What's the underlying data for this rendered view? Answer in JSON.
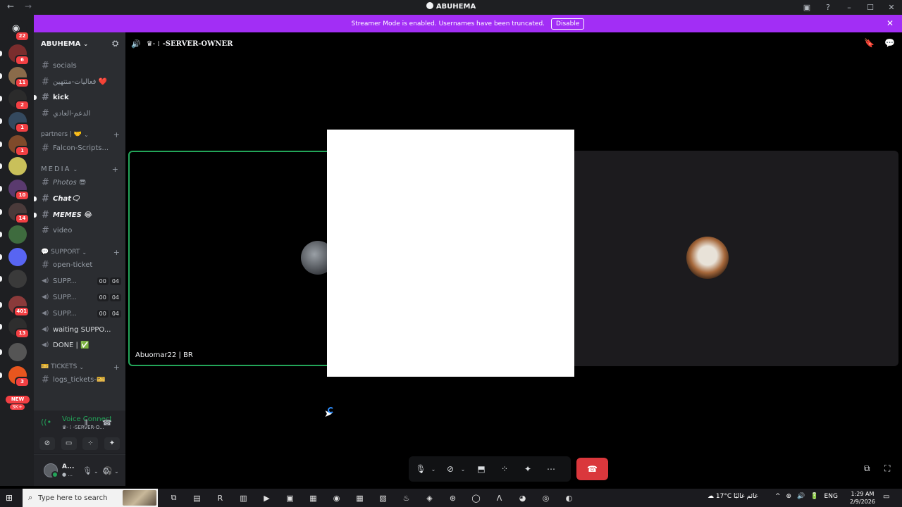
{
  "window": {
    "title": "ABUHEMA",
    "back_icon": "←",
    "forward_icon": "→",
    "controls": [
      "▣",
      "?",
      "–",
      "☐",
      "✕"
    ]
  },
  "banner": {
    "text": "Streamer Mode is enabled. Usernames have been truncated.",
    "button": "Disable",
    "close": "✕"
  },
  "rail": {
    "home_badge": "22",
    "servers": [
      {
        "badge": "6",
        "color": "#7a2d2d"
      },
      {
        "badge": "11",
        "color": "#8a6b4a"
      },
      {
        "badge": "2",
        "color": "#2b2b2b"
      },
      {
        "badge": "1",
        "color": "#34495e"
      },
      {
        "badge": "1",
        "color": "#7f4a2a"
      },
      {
        "badge": "",
        "color": "#c9c05a"
      },
      {
        "badge": "10",
        "color": "#5a3a6e"
      },
      {
        "badge": "14",
        "color": "#4a3a3a"
      },
      {
        "badge": "",
        "color": "#3e6b3e"
      },
      {
        "badge": "",
        "color": "#5865f2"
      },
      {
        "badge": "",
        "color": "#3a3a3a"
      },
      {
        "badge": "401",
        "color": "#8a3a3a"
      },
      {
        "badge": "13",
        "color": "#2e2e2e"
      },
      {
        "badge": "",
        "color": "#555555"
      },
      {
        "badge": "3",
        "color": "#e8561e"
      }
    ],
    "new_label": "NEW",
    "new_count": "3K+"
  },
  "sidebar": {
    "guild_name": "ABUHEMA",
    "chevron": "⌄",
    "invite_icon": "⛭",
    "channels_top": [
      {
        "name": "socials",
        "unread": false
      },
      {
        "name": "فعاليات-منتهين ❤️",
        "unread": false
      },
      {
        "name": "kick",
        "unread": true
      },
      {
        "name": "الدعم-العادي",
        "unread": false
      }
    ],
    "category_partners": "partners | 🤝",
    "channel_partner": "Falcon-Scripts...",
    "category_media": "MEDIA",
    "media_channels": [
      {
        "name": "Photos 😎",
        "unread": false
      },
      {
        "name": "Chat🗨",
        "unread": true
      },
      {
        "name": "MEMES 😂",
        "unread": true
      },
      {
        "name": "video",
        "unread": false
      }
    ],
    "category_support": "💬 SUPPORT",
    "support_text_channel": "open-ticket",
    "support_voice": [
      {
        "name": "SUPP...",
        "t1": "00",
        "t2": "04"
      },
      {
        "name": "SUPP...",
        "t1": "00",
        "t2": "04"
      },
      {
        "name": "SUPP...",
        "t1": "00",
        "t2": "04"
      }
    ],
    "waiting_channel": "waiting SUPPO...",
    "done_channel": "DONE | ✅",
    "category_tickets": "🎫 TICKETS",
    "logs_channel": "logs_tickets-🎫",
    "plus": "+"
  },
  "voice_panel": {
    "title": "Voice Connected",
    "subtitle": "♛- ⁞ -SERVER-O...",
    "signal_icon": "((•",
    "wave_icon": "⫴",
    "disconnect_icon": "☎",
    "buttons": [
      "⊘",
      "▭",
      "⁘",
      "✦"
    ]
  },
  "user_panel": {
    "name": "A...",
    "status": "● ...",
    "mic_icon": "🎙",
    "headset_icon": "🎧",
    "settings_icon": "⚙",
    "dropdown": "⌄"
  },
  "call": {
    "header_icon": "🔊",
    "channel_crown": "♛- ⁞",
    "channel_name": "-SERVER-OWNER",
    "header_right": [
      "🔖",
      "💬"
    ],
    "left_tile_label": "Abuomar22 | BR"
  },
  "controls": {
    "mic": "🎙",
    "camera": "⊘",
    "screen": "⬒",
    "activities": "⁘",
    "soundboard": "✦",
    "more": "⋯",
    "chevron": "⌄",
    "hangup": "☎",
    "popout": "⧉",
    "fullscreen": "⛶"
  },
  "taskbar": {
    "start": "⊞",
    "search_placeholder": "Type here to search",
    "search_icon": "⌕",
    "apps": [
      "⧉",
      "▤",
      "R",
      "▥",
      "▶",
      "▣",
      "▦",
      "◉",
      "▦",
      "▧",
      "♨",
      "◈",
      "⊛",
      "◯",
      "Λ",
      "◕",
      "◎",
      "◐"
    ],
    "weather": "☁ 17°C غائم غالبًا",
    "tray": [
      "^",
      "⊕",
      "🔊",
      "🔋",
      "ENG"
    ],
    "time": "1:29 AM",
    "date": "2/9/2026",
    "notifications": "▭"
  }
}
